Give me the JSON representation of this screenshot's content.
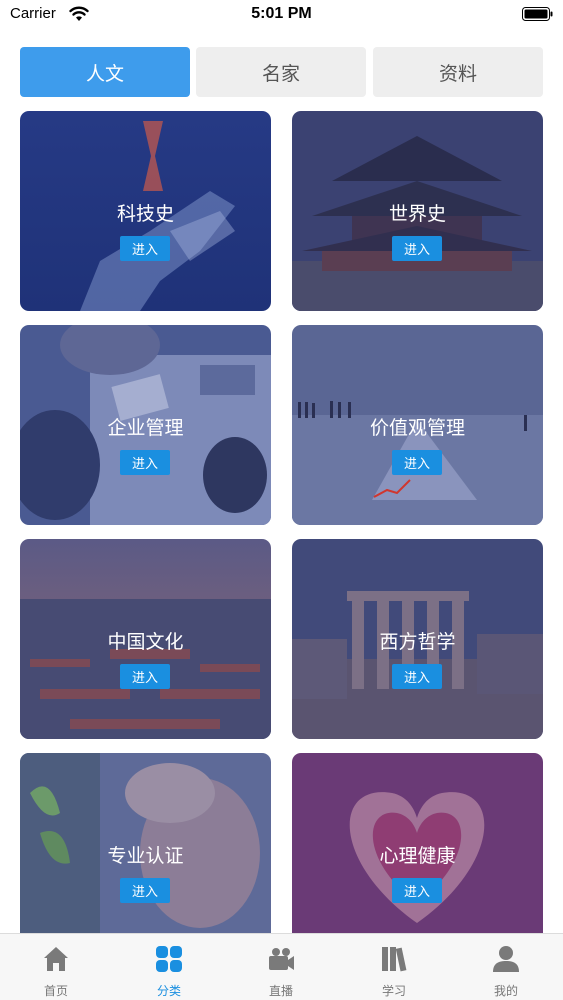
{
  "status_bar": {
    "carrier": "Carrier",
    "time": "5:01 PM"
  },
  "tabs": [
    {
      "label": "人文",
      "active": true
    },
    {
      "label": "名家",
      "active": false
    },
    {
      "label": "资料",
      "active": false
    }
  ],
  "cards": [
    {
      "title": "科技史",
      "button": "进入"
    },
    {
      "title": "世界史",
      "button": "进入"
    },
    {
      "title": "企业管理",
      "button": "进入"
    },
    {
      "title": "价值观管理",
      "button": "进入"
    },
    {
      "title": "中国文化",
      "button": "进入"
    },
    {
      "title": "西方哲学",
      "button": "进入"
    },
    {
      "title": "专业认证",
      "button": "进入"
    },
    {
      "title": "心理健康",
      "button": "进入"
    }
  ],
  "tabbar": [
    {
      "label": "首页",
      "icon": "home-icon",
      "active": false
    },
    {
      "label": "分类",
      "icon": "grid-icon",
      "active": true
    },
    {
      "label": "直播",
      "icon": "video-camera-icon",
      "active": false
    },
    {
      "label": "学习",
      "icon": "books-icon",
      "active": false
    },
    {
      "label": "我的",
      "icon": "person-icon",
      "active": false
    }
  ],
  "colors": {
    "accent": "#3e9cec",
    "button_blue": "#1a8fe0",
    "card_overlay": "#2b3a80"
  }
}
